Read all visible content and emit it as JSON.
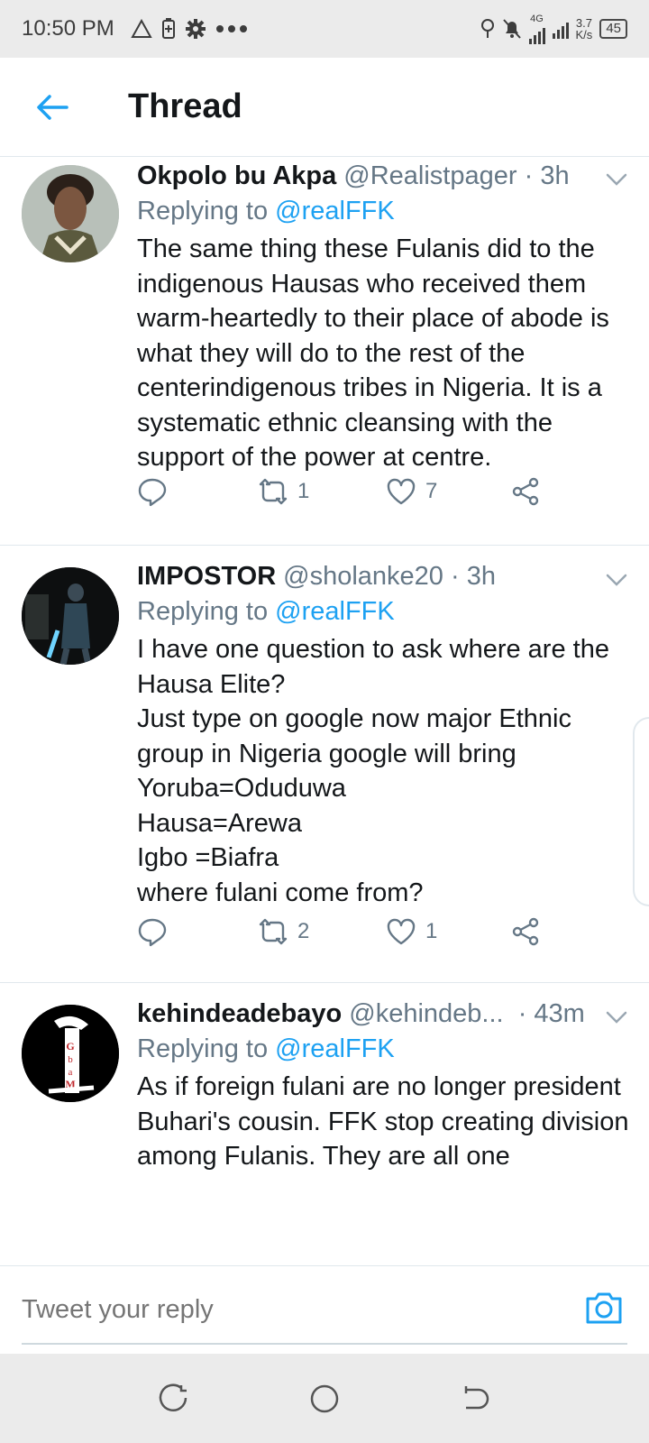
{
  "status_bar": {
    "time": "10:50 PM",
    "speed_value": "3.7",
    "speed_unit": "K/s",
    "network": "4G",
    "battery": "45"
  },
  "header": {
    "title": "Thread"
  },
  "tweets": [
    {
      "name": "Okpolo bu Akpa",
      "handle": "@Realistpager",
      "time": "· 3h",
      "replying_prefix": "Replying to ",
      "replying_to": "@realFFK",
      "text": "The same thing these Fulanis did to the indigenous Hausas who received them warm-heartedly to their place of abode is what they will do to the rest of the centerindigenous tribes in Nigeria. It is a systematic ethnic cleansing with the support of the power at centre.",
      "retweets": "1",
      "likes": "7"
    },
    {
      "name": "IMPOSTOR",
      "handle": "@sholanke20",
      "time": "· 3h",
      "replying_prefix": "Replying to ",
      "replying_to": "@realFFK",
      "text": "I have one question to ask where are the Hausa Elite?\nJust type on google now major Ethnic group in Nigeria google will bring\nYoruba=Oduduwa\nHausa=Arewa\nIgbo =Biafra\n where fulani come from?",
      "retweets": "2",
      "likes": "1"
    },
    {
      "name": "kehindeadebayo",
      "handle": "@kehindeb...",
      "time": "· 43m",
      "replying_prefix": "Replying to ",
      "replying_to": "@realFFK",
      "text": "As if foreign fulani are no longer president Buhari's cousin. FFK stop creating division among Fulanis. They are all one"
    }
  ],
  "reply_bar": {
    "placeholder": "Tweet your reply"
  },
  "colors": {
    "accent": "#1da1f2",
    "secondary_text": "#657786",
    "primary_text": "#14171a"
  }
}
